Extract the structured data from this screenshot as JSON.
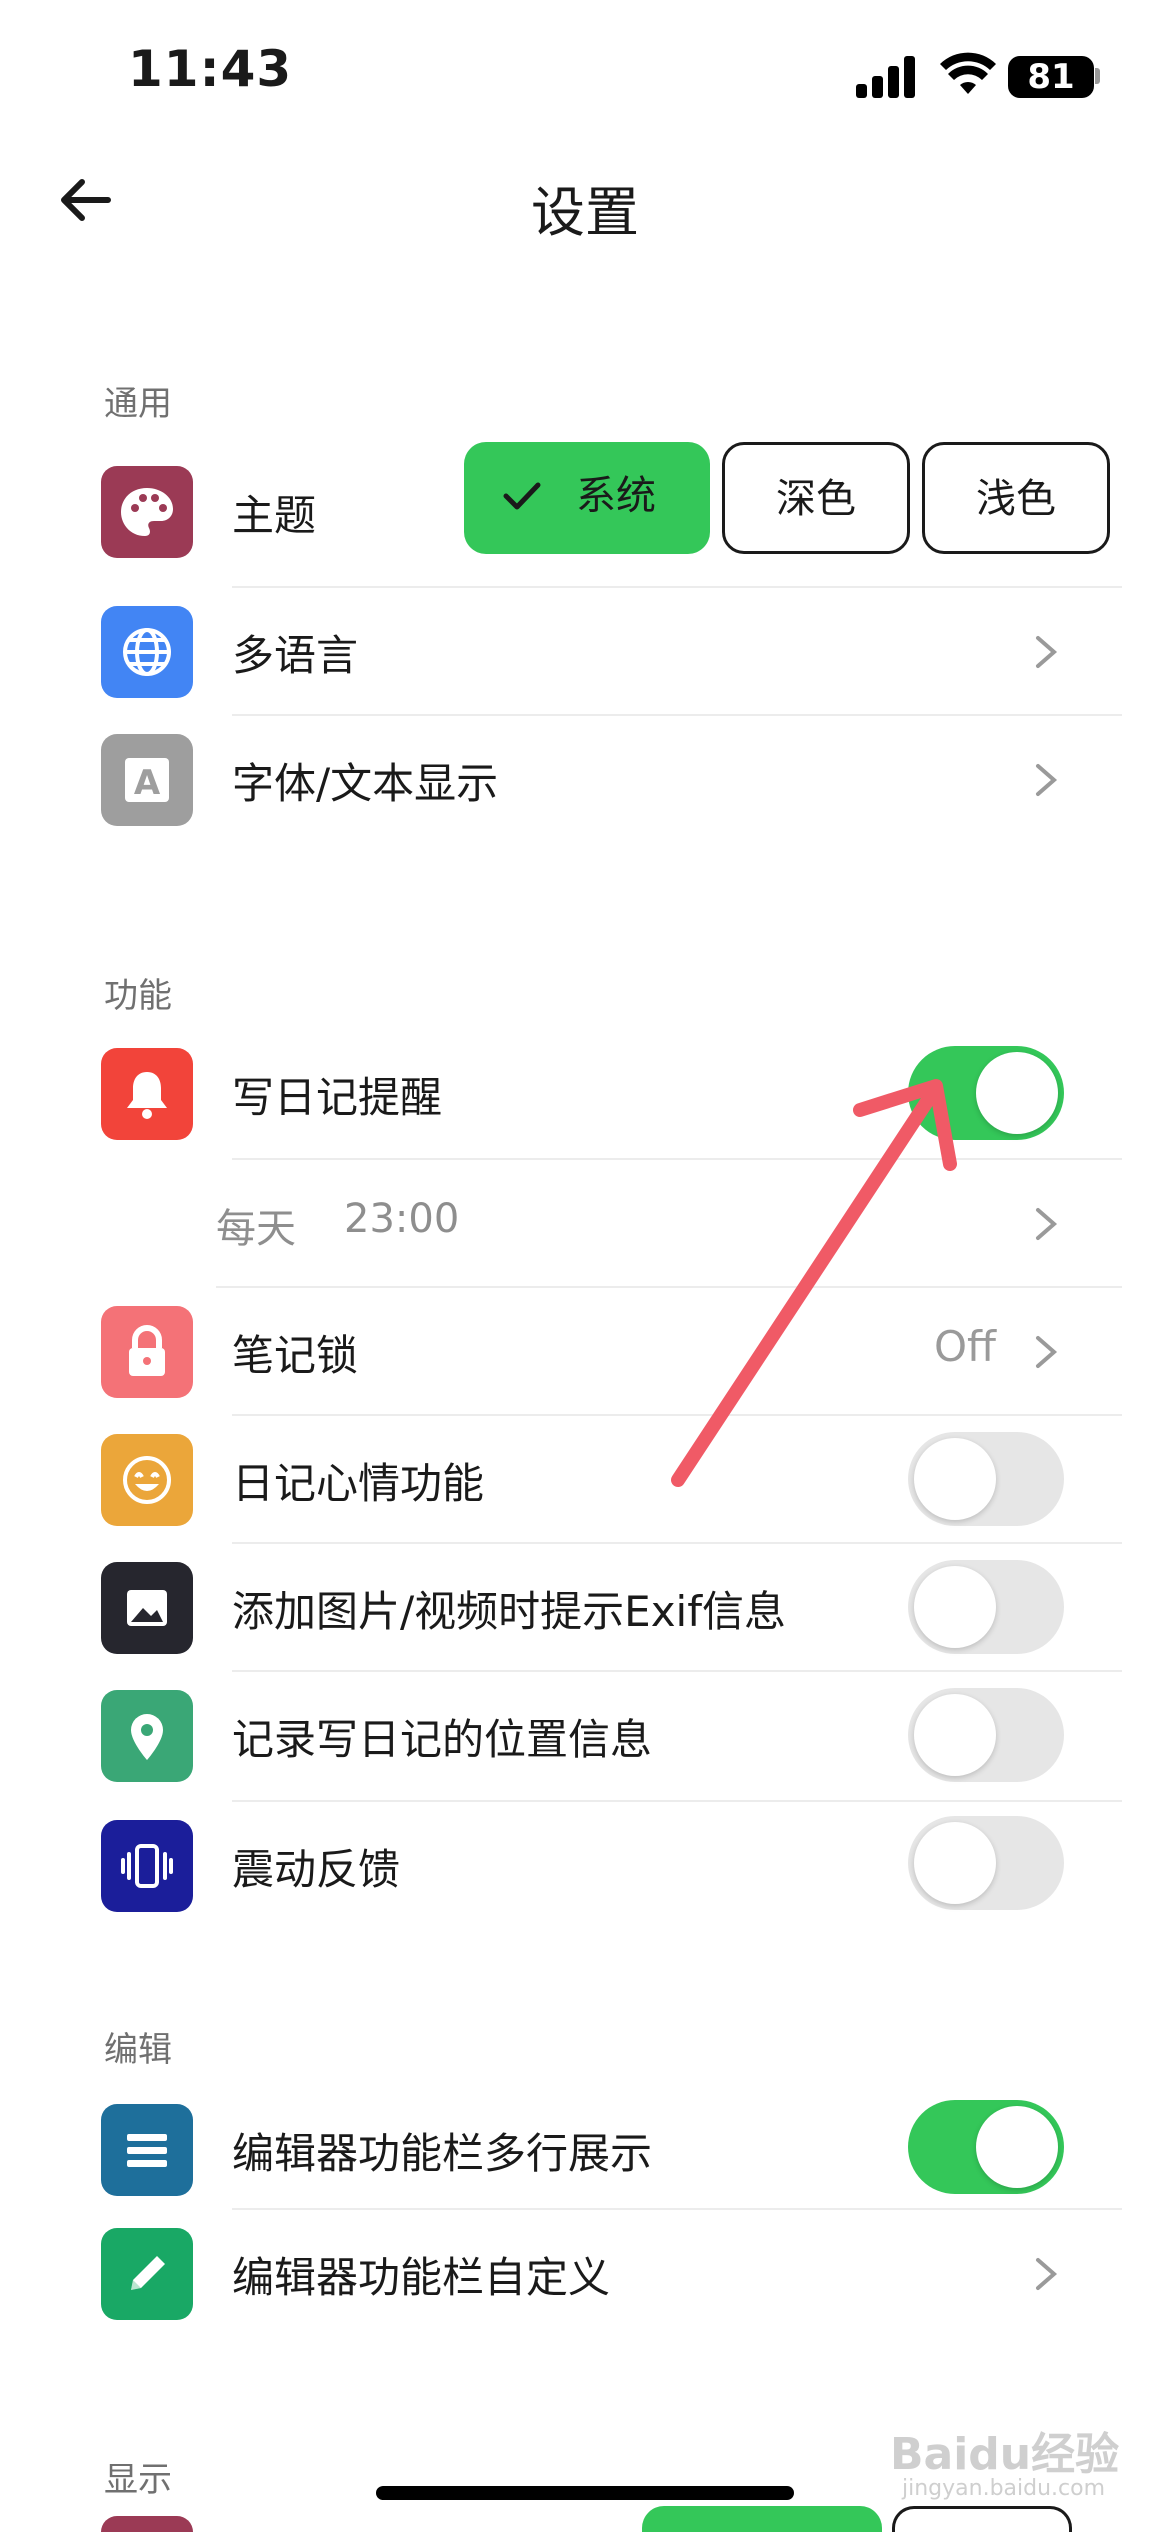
{
  "status_bar": {
    "time": "11:43",
    "battery": "81"
  },
  "nav": {
    "title": "设置"
  },
  "sections": {
    "general": "通用",
    "features": "功能",
    "edit": "编辑",
    "display": "显示"
  },
  "general": {
    "theme_label": "主题",
    "theme_options": [
      "系统",
      "深色",
      "浅色"
    ],
    "theme_selected": "系统",
    "language_label": "多语言",
    "font_label": "字体/文本显示"
  },
  "features": {
    "reminder_label": "写日记提醒",
    "reminder_on": true,
    "reminder_schedule_day": "每天",
    "reminder_schedule_time": "23:00",
    "notelock_label": "笔记锁",
    "notelock_value": "Off",
    "mood_label": "日记心情功能",
    "mood_on": false,
    "exif_label": "添加图片/视频时提示Exif信息",
    "exif_on": false,
    "location_label": "记录写日记的位置信息",
    "location_on": false,
    "haptic_label": "震动反馈",
    "haptic_on": false
  },
  "edit": {
    "multiline_label": "编辑器功能栏多行展示",
    "multiline_on": true,
    "custom_label": "编辑器功能栏自定义"
  },
  "watermark": {
    "brand": "Baidu经验",
    "url": "jingyan.baidu.com"
  },
  "colors": {
    "accent_green": "#34c759",
    "theme_icon": "#9b3a55",
    "language_icon": "#4285f4",
    "font_icon": "#9e9e9e",
    "reminder_icon": "#f2443a",
    "lock_icon": "#f47277",
    "mood_icon": "#eba63a",
    "exif_icon": "#26262e",
    "location_icon": "#3aa776",
    "haptic_icon": "#1b1e9a",
    "multiline_icon": "#1e6f9b",
    "custom_icon": "#19a865",
    "annotation_arrow": "#f05a66"
  }
}
